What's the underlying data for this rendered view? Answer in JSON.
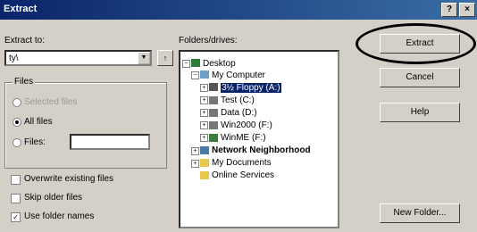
{
  "window": {
    "title": "Extract",
    "help_label": "?",
    "close_label": "×"
  },
  "left": {
    "extract_to_label": "Extract to:",
    "extract_to_value": "ty\\",
    "up_label": "↑",
    "files_group_label": "Files",
    "selected_files_label": "Selected files",
    "all_files_label": "All files",
    "files_label": "Files:",
    "files_value": "",
    "overwrite_label": "Overwrite existing files",
    "skip_older_label": "Skip older files",
    "use_folder_names_label": "Use folder names",
    "overwrite_checked": false,
    "skip_older_checked": false,
    "use_folder_names_checked": true
  },
  "tree": {
    "label": "Folders/drives:",
    "items": {
      "desktop": "Desktop",
      "my_computer": "My Computer",
      "floppy": "3½ Floppy (A:)",
      "test": "Test (C:)",
      "data": "Data (D:)",
      "win2000": "Win2000 (F:)",
      "winme": "WinME (F:)",
      "network": "Network Neighborhood",
      "my_documents": "My Documents",
      "online_services": "Online Services"
    }
  },
  "buttons": {
    "extract": "Extract",
    "cancel": "Cancel",
    "help": "Help",
    "new_folder": "New Folder..."
  },
  "colors": {
    "selection": "#0a246a",
    "dialog_bg": "#d4d0c8",
    "title_bar": "#0a246a"
  }
}
